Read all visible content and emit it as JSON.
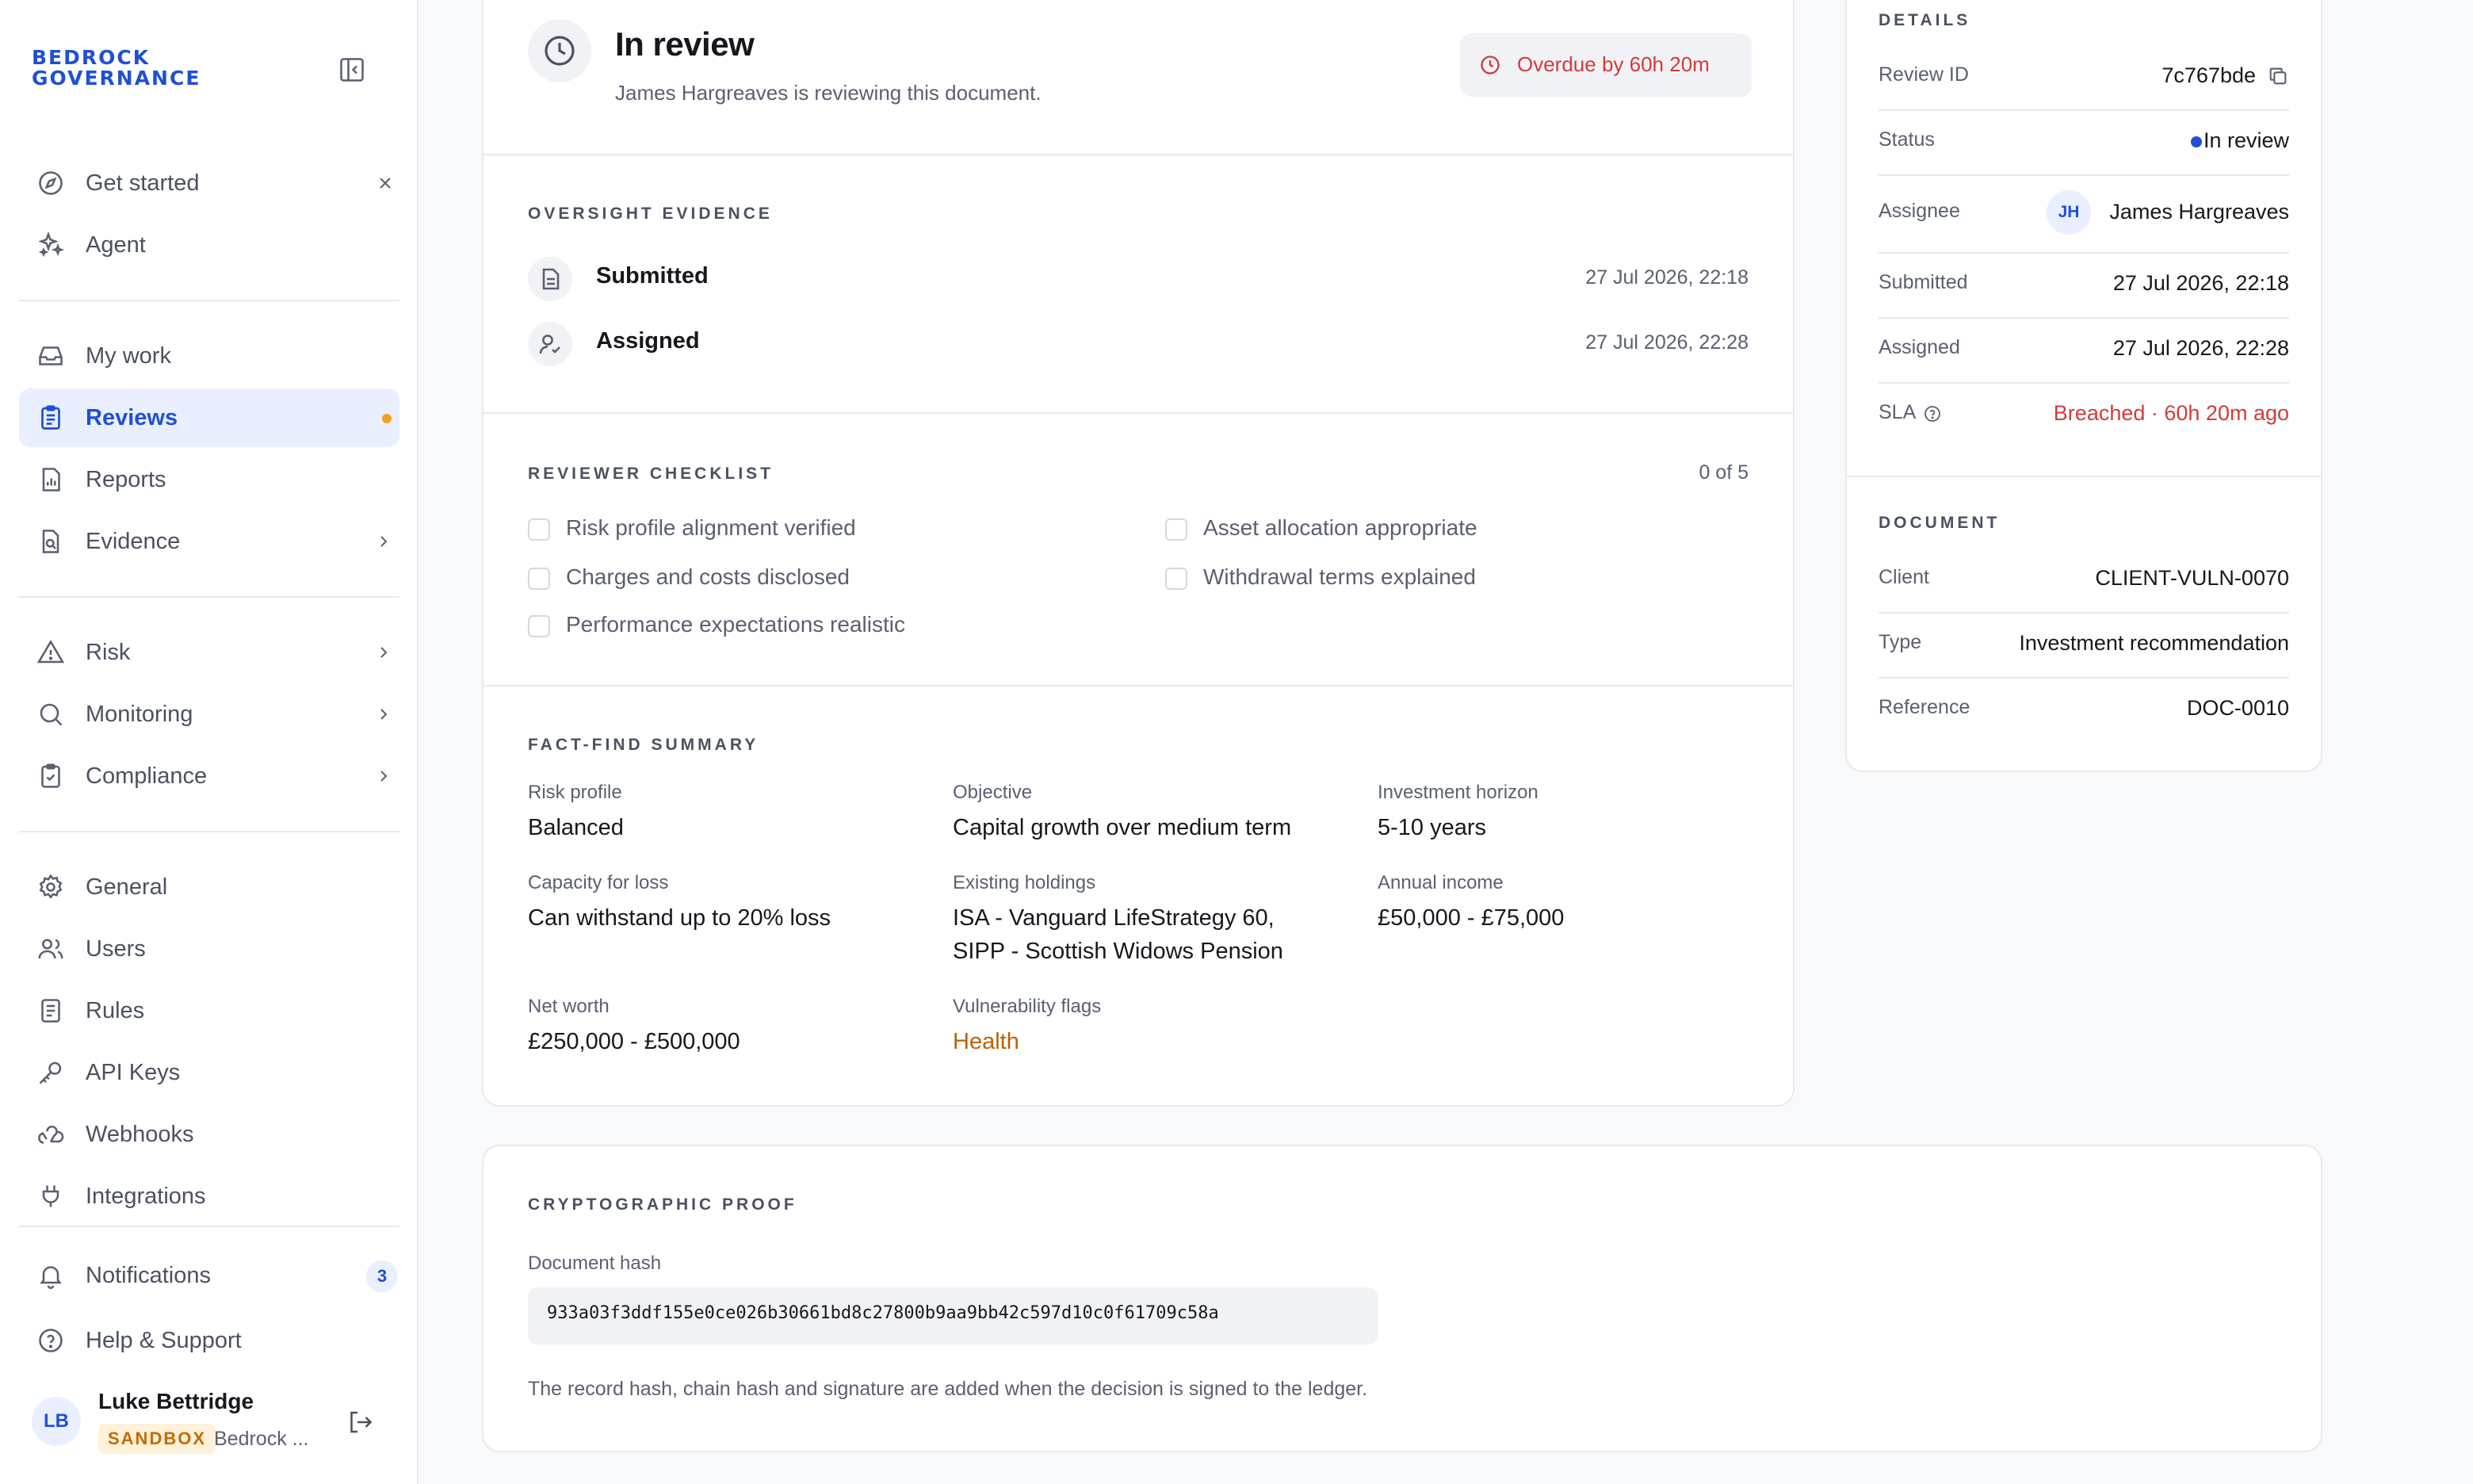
{
  "brand": {
    "line1": "BEDROCK",
    "line2": "GOVERNANCE",
    "color": "#1f4fd6"
  },
  "sidebar": {
    "items": [
      {
        "label": "Get started",
        "icon": "compass-icon"
      },
      {
        "label": "Agent",
        "icon": "sparkles-icon"
      },
      {
        "label": "My work",
        "icon": "inbox-icon"
      },
      {
        "label": "Reviews",
        "icon": "clipboard-icon",
        "active": true
      },
      {
        "label": "Reports",
        "icon": "report-icon"
      },
      {
        "label": "Evidence",
        "icon": "file-search-icon"
      },
      {
        "label": "Risk",
        "icon": "warning-icon"
      },
      {
        "label": "Monitoring",
        "icon": "search-icon"
      },
      {
        "label": "Compliance",
        "icon": "clipboard-check-icon"
      },
      {
        "label": "General",
        "icon": "gear-icon"
      },
      {
        "label": "Users",
        "icon": "users-icon"
      },
      {
        "label": "Rules",
        "icon": "rules-icon"
      },
      {
        "label": "API Keys",
        "icon": "key-icon"
      },
      {
        "label": "Webhooks",
        "icon": "webhook-icon"
      },
      {
        "label": "Integrations",
        "icon": "plug-icon"
      },
      {
        "label": "Notifications",
        "icon": "bell-icon",
        "count": "3"
      },
      {
        "label": "Help & Support",
        "icon": "help-icon"
      }
    ]
  },
  "user": {
    "initials": "LB",
    "name": "Luke Bettridge",
    "badge": "SANDBOX",
    "org": "Bedrock ..."
  },
  "status_card": {
    "title": "In review",
    "subtitle": "James Hargreaves is reviewing this document.",
    "overdue": "Overdue by 60h 20m"
  },
  "oversight": {
    "title": "OVERSIGHT EVIDENCE",
    "events": [
      {
        "label": "Submitted",
        "time": "27 Jul 2026, 22:18"
      },
      {
        "label": "Assigned",
        "time": "27 Jul 2026, 22:28"
      }
    ]
  },
  "checklist": {
    "title": "REVIEWER CHECKLIST",
    "progress": "0 of 5",
    "items": [
      "Risk profile alignment verified",
      "Asset allocation appropriate",
      "Charges and costs disclosed",
      "Withdrawal terms explained",
      "Performance expectations realistic"
    ]
  },
  "factfind": {
    "title": "FACT-FIND SUMMARY",
    "fields": [
      {
        "label": "Risk profile",
        "value": "Balanced"
      },
      {
        "label": "Objective",
        "value": "Capital growth over medium term"
      },
      {
        "label": "Investment horizon",
        "value": "5-10 years"
      },
      {
        "label": "Capacity for loss",
        "value": "Can withstand up to 20% loss"
      },
      {
        "label": "Existing holdings",
        "value": "ISA - Vanguard LifeStrategy 60,",
        "value2": "SIPP - Scottish Widows Pension"
      },
      {
        "label": "Annual income",
        "value": "£50,000 - £75,000"
      },
      {
        "label": "Net worth",
        "value": "£250,000 - £500,000"
      },
      {
        "label": "Vulnerability flags",
        "value": "Health"
      }
    ]
  },
  "proof": {
    "title": "CRYPTOGRAPHIC PROOF",
    "hash_label": "Document hash",
    "hash": "933a03f3ddf155e0ce026b30661bd8c27800b9aa9bb42c597d10c0f61709c58a",
    "note": "The record hash, chain hash and signature are added when the decision is signed to the ledger."
  },
  "details": {
    "title": "DETAILS",
    "review_id_label": "Review ID",
    "review_id": "7c767bde",
    "status_label": "Status",
    "status": "In review",
    "assignee_label": "Assignee",
    "assignee_initials": "JH",
    "assignee": "James Hargreaves",
    "submitted_label": "Submitted",
    "submitted": "27 Jul 2026, 22:18",
    "assigned_label": "Assigned",
    "assigned": "27 Jul 2026, 22:28",
    "sla_label": "SLA",
    "sla": "Breached · 60h 20m ago"
  },
  "document": {
    "title": "DOCUMENT",
    "client_label": "Client",
    "client": "CLIENT-VULN-0070",
    "type_label": "Type",
    "type": "Investment recommendation",
    "reference_label": "Reference",
    "reference": "DOC-0010"
  },
  "colors": {
    "accent": "#1f4fd6",
    "danger": "#d23b3b",
    "warning": "#b8620a"
  }
}
